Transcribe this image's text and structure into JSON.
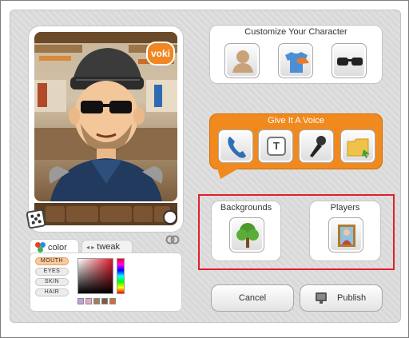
{
  "app": {
    "badge": "voki"
  },
  "customize": {
    "title": "Customize Your Character",
    "buttons": [
      {
        "icon": "person-icon"
      },
      {
        "icon": "tshirt-cap-icon"
      },
      {
        "icon": "sunglasses-icon"
      }
    ]
  },
  "voice": {
    "title": "Give It A Voice",
    "buttons": [
      {
        "icon": "phone-icon"
      },
      {
        "icon": "text-key-icon",
        "key_label": "T"
      },
      {
        "icon": "microphone-icon"
      },
      {
        "icon": "folder-icon"
      }
    ]
  },
  "backgrounds": {
    "title": "Backgrounds",
    "icon": "tree-icon"
  },
  "players": {
    "title": "Players",
    "icon": "picture-frame-icon"
  },
  "actions": {
    "cancel_label": "Cancel",
    "publish_label": "Publish"
  },
  "colorpanel": {
    "tabs": {
      "color": "color",
      "tweak": "tweak"
    },
    "parts": [
      "MOUTH",
      "EYES",
      "SKIN",
      "HAIR"
    ],
    "selected_part": "MOUTH",
    "swatches": [
      "#c9a0d6",
      "#e6a8c9",
      "#a37c5c",
      "#7d5b3f",
      "#d56a3c"
    ]
  },
  "colors": {
    "accent": "#f08a1e",
    "highlight": "#e11f2b",
    "scene_floor": "#5b3d22"
  }
}
